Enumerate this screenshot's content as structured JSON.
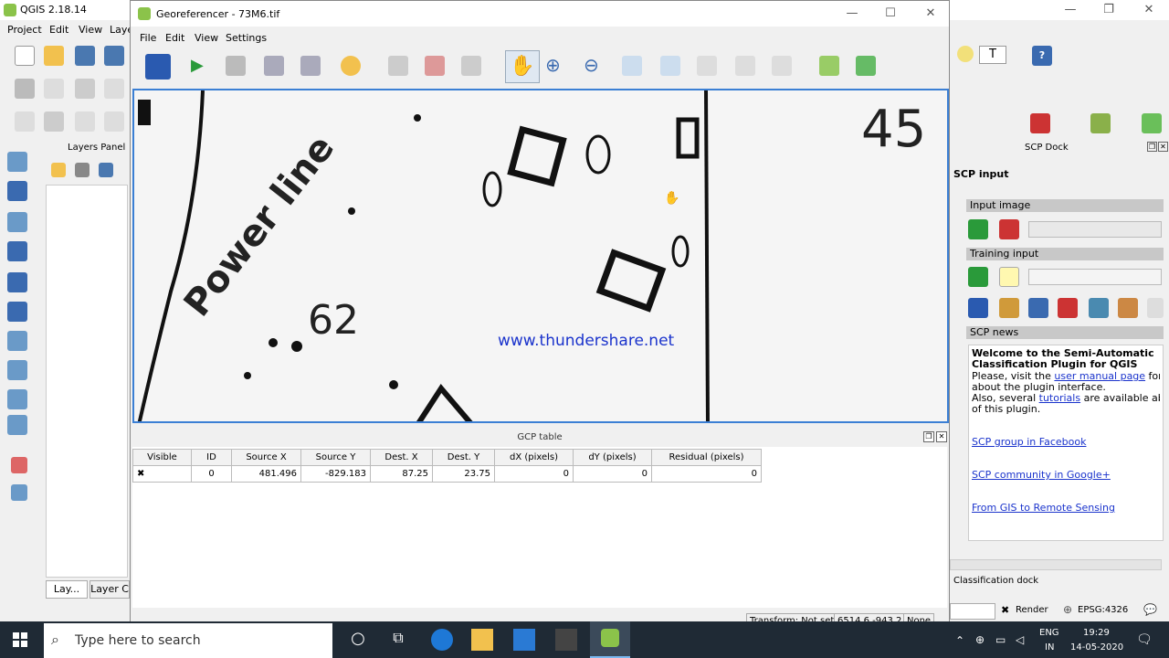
{
  "qgis": {
    "title": "QGIS 2.18.14",
    "menu": [
      "Project",
      "Edit",
      "View",
      "Laye"
    ],
    "layers_panel_title": "Layers Panel",
    "tabs": [
      "Lay...",
      "Layer C"
    ],
    "window_controls": {
      "minimize": "—",
      "restore": "❐",
      "close": "✕"
    }
  },
  "georef": {
    "title": "Georeferencer - 73M6.tif",
    "menu": [
      "File",
      "Edit",
      "View",
      "Settings"
    ],
    "window_controls": {
      "minimize": "—",
      "maximize": "☐",
      "close": "✕"
    },
    "watermark": "www.thundershare.net",
    "map_text": {
      "power_line": "Power line",
      "number_62": "62",
      "number_45": "45"
    },
    "gcp_table_title": "GCP table",
    "gcp_columns": [
      "Visible",
      "ID",
      "Source X",
      "Source Y",
      "Dest. X",
      "Dest. Y",
      "dX (pixels)",
      "dY (pixels)",
      "Residual (pixels)"
    ],
    "gcp_rows": [
      {
        "visible": "✖",
        "id": "0",
        "source_x": "481.496",
        "source_y": "-829.183",
        "dest_x": "87.25",
        "dest_y": "23.75",
        "dx": "0",
        "dy": "0",
        "residual": "0"
      }
    ],
    "status": {
      "transform": "Transform: Not set",
      "coords": "6514.6,-943.2",
      "none": "None"
    }
  },
  "scp": {
    "dock_title": "SCP Dock",
    "input_title": "SCP input",
    "input_image": "Input image",
    "training_input": "Training input",
    "news_title": "SCP news",
    "news_heading": "Welcome to the Semi-Automatic Classification Plugin for QGIS",
    "news_line1_pre": "Please, visit the ",
    "news_line1_link": "user manual page",
    "news_line1_post": " for informat",
    "news_line2": "about the plugin interface.",
    "news_line3_pre": "Also, several ",
    "news_line3_link": "tutorials",
    "news_line3_post": " are available about the u",
    "news_line4": "of this plugin.",
    "link_facebook": "SCP group in Facebook",
    "link_google": "SCP community in Google+",
    "link_gis": "From GIS to Remote Sensing",
    "classification_dock": "Classification dock",
    "render": "Render",
    "epsg": "EPSG:4326"
  },
  "taskbar": {
    "search_placeholder": "Type here to search",
    "lang": "ENG",
    "region": "IN",
    "time": "19:29",
    "date": "14-05-2020"
  },
  "colors": {
    "accent": "#3b7fd4",
    "taskbar": "#1f2a35",
    "link": "#1a33cc",
    "watermark": "#1a33cc"
  }
}
